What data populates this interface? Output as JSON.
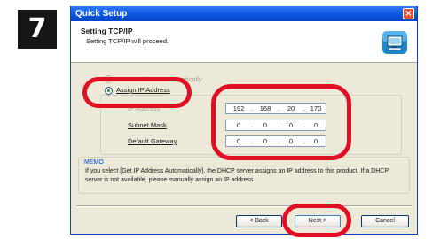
{
  "step_number": "7",
  "window": {
    "title": "Quick Setup",
    "close_label": "×"
  },
  "header": {
    "title": "Setting TCP/IP",
    "subtitle": "Setting TCP/IP will proceed.",
    "icon": "network-computer-icon"
  },
  "options": {
    "auto_label": "Get IP Address Automatically",
    "manual_label": "Assign IP Address",
    "selected": "manual"
  },
  "fields": [
    {
      "label": "IP Address",
      "octets": [
        "192",
        "168",
        "20",
        "170"
      ]
    },
    {
      "label": "Subnet Mask",
      "octets": [
        "0",
        "0",
        "0",
        "0"
      ]
    },
    {
      "label": "Default Gateway",
      "octets": [
        "0",
        "0",
        "0",
        "0"
      ]
    }
  ],
  "memo": {
    "title": "MEMO",
    "text": "If you select [Get IP Address Automatically], the DHCP server assigns an IP address to this product. If a DHCP server is not available, please manually assign an IP address."
  },
  "buttons": {
    "back": "< Back",
    "next": "Next >",
    "cancel": "Cancel"
  },
  "annotation_color": "#e10f23"
}
